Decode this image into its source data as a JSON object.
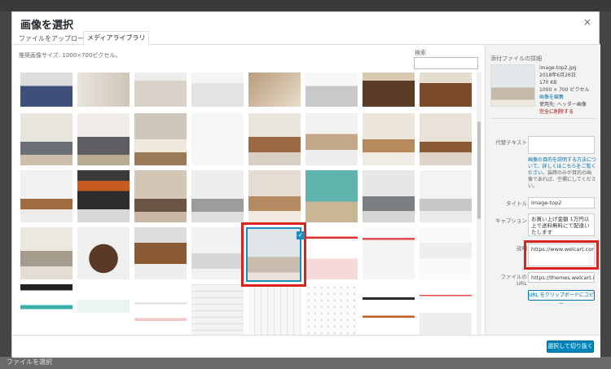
{
  "modal": {
    "title": "画像を選択",
    "close_label": "×"
  },
  "tabs": [
    {
      "label": "ファイルをアップロード",
      "active": false
    },
    {
      "label": "メディアライブラリ",
      "active": true
    }
  ],
  "toolbar_top": {
    "sizes_note": "推奨画像サイズ: 1000×700ピクセル。",
    "search_label": "検索",
    "search_value": ""
  },
  "selected_check": "✓",
  "sidebar": {
    "title": "添付ファイルの詳細",
    "file_name": "image-top2.jpg",
    "date": "2018年6月26日",
    "size": "170 KB",
    "dimensions": "1000 × 700 ピクセル",
    "edit_link": "画像を編集",
    "used_in": "使用先: ヘッダー画像",
    "delete_link": "完全に削除する",
    "alt_label": "代替テキスト",
    "alt_value": "",
    "alt_help_link": "画像の目的を説明する方法について、詳しくはこちらをご覧ください",
    "alt_help_text": "。装飾のみが目的の画像であれば、空欄にしてください。",
    "title_label": "タイトル",
    "title_value": "image-top2",
    "caption_label": "キャプション",
    "caption_value": "お買い上げ金額 1万円以上で送料無料にて配達いたします",
    "description_label": "説明",
    "description_value": "https://www.welcart.com/community/forums",
    "file_url_label": "ファイルのURL",
    "file_url_value": "https://themes.welcart.info...",
    "copy_button": "URL をクリップボードにコピー"
  },
  "primary_button": "選択して切り抜く",
  "background": {
    "bottom_text": "ファイルを選択"
  }
}
